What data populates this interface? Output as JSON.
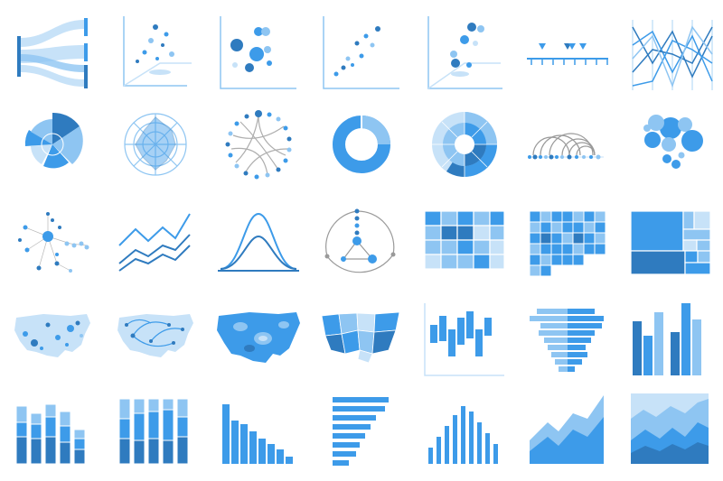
{
  "palette": {
    "dark": "#2f7bbf",
    "mid": "#3d9be9",
    "light": "#8ec5f2",
    "pale": "#c7e2f8",
    "gray": "#9a9a9a",
    "background": "#ffffff"
  },
  "icons": [
    {
      "name": "sankey-chart-icon"
    },
    {
      "name": "scatter-3d-chart-icon"
    },
    {
      "name": "bubble-chart-icon"
    },
    {
      "name": "scatter-chart-icon"
    },
    {
      "name": "bubble-3d-chart-icon"
    },
    {
      "name": "timeline-chart-icon"
    },
    {
      "name": "parallel-coordinates-chart-icon"
    },
    {
      "name": "polar-area-chart-icon"
    },
    {
      "name": "radar-chart-icon"
    },
    {
      "name": "chord-diagram-icon"
    },
    {
      "name": "donut-chart-icon"
    },
    {
      "name": "sunburst-chart-icon"
    },
    {
      "name": "arc-diagram-icon"
    },
    {
      "name": "packed-circles-icon"
    },
    {
      "name": "network-graph-icon"
    },
    {
      "name": "line-chart-icon"
    },
    {
      "name": "distribution-curve-icon"
    },
    {
      "name": "hierarchy-graph-icon"
    },
    {
      "name": "heatmap-icon"
    },
    {
      "name": "calendar-heatmap-icon"
    },
    {
      "name": "treemap-icon"
    },
    {
      "name": "dot-map-icon"
    },
    {
      "name": "flow-map-icon"
    },
    {
      "name": "contour-map-icon"
    },
    {
      "name": "choropleth-map-icon"
    },
    {
      "name": "candlestick-chart-icon"
    },
    {
      "name": "population-pyramid-icon"
    },
    {
      "name": "column-chart-icon"
    },
    {
      "name": "stacked-column-chart-icon"
    },
    {
      "name": "stacked-percent-chart-icon"
    },
    {
      "name": "histogram-icon"
    },
    {
      "name": "horizontal-bar-chart-icon"
    },
    {
      "name": "bell-histogram-icon"
    },
    {
      "name": "area-chart-icon"
    },
    {
      "name": "stacked-area-chart-icon"
    }
  ]
}
